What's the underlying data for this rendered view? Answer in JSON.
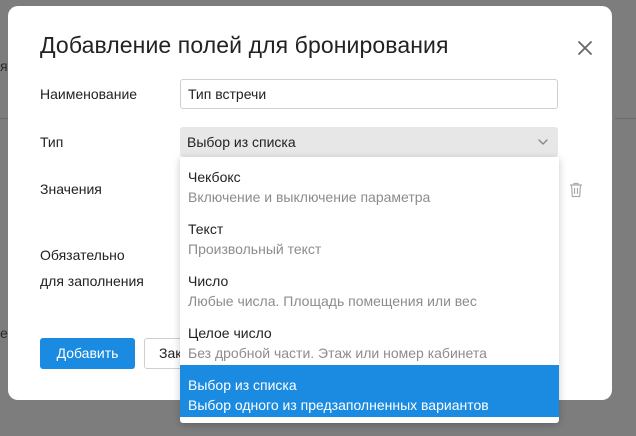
{
  "background": {
    "fragment_right_top": "я",
    "fragment_left_mid": "е"
  },
  "modal": {
    "title": "Добавление полей для бронирования",
    "close_icon": "close-icon"
  },
  "form": {
    "name_label": "Наименование",
    "name_value": "Тип встречи",
    "type_label": "Тип",
    "type_value": "Выбор из списка",
    "values_label": "Значения",
    "required_label_line1": "Обязательно",
    "required_label_line2": "для заполнения"
  },
  "dropdown": {
    "options": [
      {
        "title": "Чекбокс",
        "description": "Включение и выключение параметра",
        "selected": false
      },
      {
        "title": "Текст",
        "description": "Произвольный текст",
        "selected": false
      },
      {
        "title": "Число",
        "description": "Любые числа. Площадь помещения или вес",
        "selected": false
      },
      {
        "title": "Целое число",
        "description": "Без дробной части. Этаж или номер кабинета",
        "selected": false
      },
      {
        "title": "Выбор из списка",
        "description": "Выбор одного из предзаполненных вариантов",
        "selected": true
      }
    ]
  },
  "buttons": {
    "add_label": "Добавить",
    "cancel_label_visible": "Зак"
  },
  "colors": {
    "accent": "#1a8be0",
    "overlay": "#7d7d7d",
    "muted_text": "#8c8c8c"
  }
}
